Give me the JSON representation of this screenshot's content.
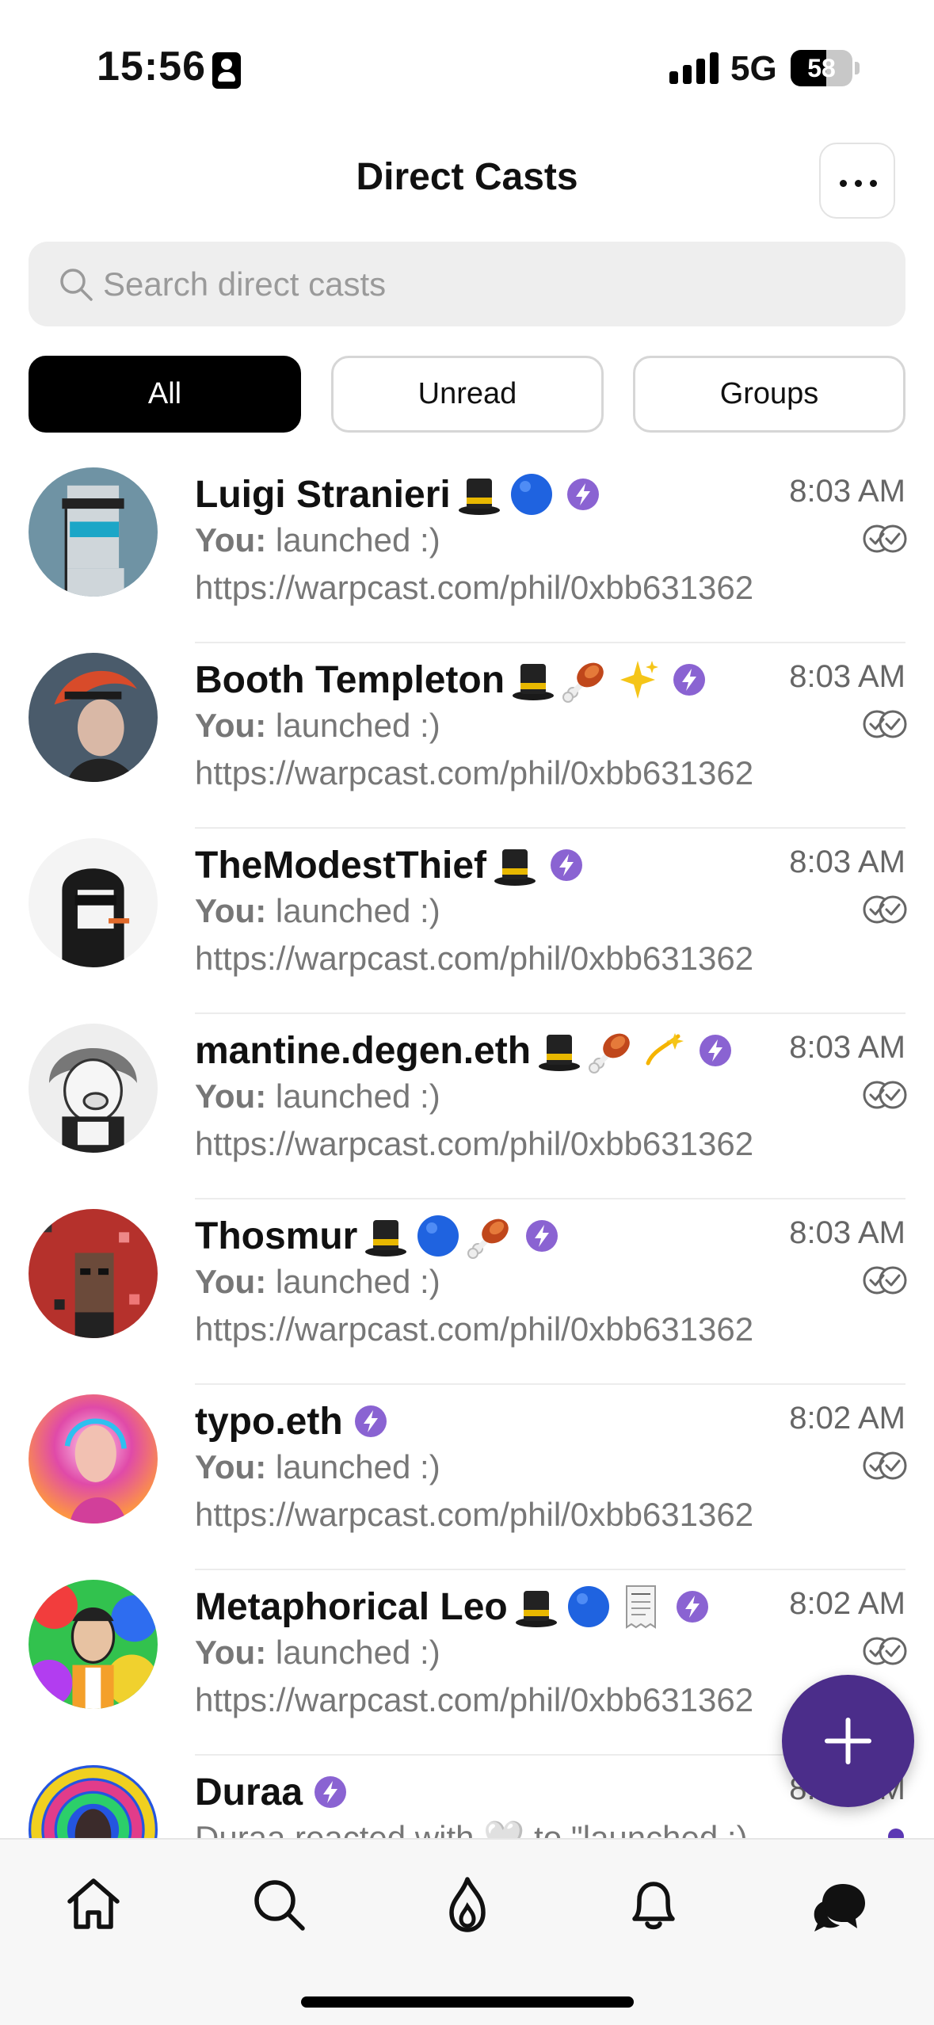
{
  "status_bar": {
    "time": "15:56",
    "network": "5G",
    "battery_level": "58",
    "battery_fraction": 0.58
  },
  "header": {
    "title": "Direct Casts",
    "more_icon": "ellipsis-icon"
  },
  "search": {
    "placeholder": "Search direct casts",
    "value": ""
  },
  "tabs": [
    {
      "label": "All",
      "active": true
    },
    {
      "label": "Unread",
      "active": false
    },
    {
      "label": "Groups",
      "active": false
    }
  ],
  "conversations": [
    {
      "name": "Luigi Stranieri",
      "emojis": [
        "top-hat",
        "blue-circle"
      ],
      "verified": true,
      "time": "8:03 AM",
      "sender": "You:",
      "message": "launched :)",
      "link": "https://warpcast.com/phil/0xbb631362",
      "status": "read"
    },
    {
      "name": "Booth Templeton",
      "emojis": [
        "top-hat",
        "meat-on-bone",
        "sparkles"
      ],
      "verified": true,
      "time": "8:03 AM",
      "sender": "You:",
      "message": "launched :)",
      "link": "https://warpcast.com/phil/0xbb631362",
      "status": "read"
    },
    {
      "name": "TheModestThief",
      "emojis": [
        "top-hat"
      ],
      "verified": true,
      "time": "8:03 AM",
      "sender": "You:",
      "message": "launched :)",
      "link": "https://warpcast.com/phil/0xbb631362",
      "status": "read"
    },
    {
      "name": "mantine.degen.eth",
      "emojis": [
        "top-hat",
        "meat-on-bone",
        "dizzy"
      ],
      "verified": true,
      "time": "8:03 AM",
      "sender": "You:",
      "message": "launched :)",
      "link": "https://warpcast.com/phil/0xbb631362",
      "status": "read"
    },
    {
      "name": "Thosmur",
      "emojis": [
        "top-hat",
        "blue-circle",
        "meat-on-bone"
      ],
      "verified": true,
      "time": "8:03 AM",
      "sender": "You:",
      "message": "launched :)",
      "link": "https://warpcast.com/phil/0xbb631362",
      "status": "read"
    },
    {
      "name": "typo.eth",
      "emojis": [],
      "verified": true,
      "time": "8:02 AM",
      "sender": "You:",
      "message": "launched :)",
      "link": "https://warpcast.com/phil/0xbb631362",
      "status": "read"
    },
    {
      "name": "Metaphorical Leo",
      "emojis": [
        "top-hat",
        "blue-circle",
        "receipt"
      ],
      "verified": true,
      "time": "8:02 AM",
      "sender": "You:",
      "message": "launched :)",
      "link": "https://warpcast.com/phil/0xbb631362",
      "status": "read"
    },
    {
      "name": "Duraa",
      "emojis": [],
      "verified": true,
      "time": "8:02 AM",
      "sender": "",
      "message": "Duraa reacted with 🤍 to \"launched :)",
      "link": "",
      "status": "unread"
    }
  ],
  "fab": {
    "icon": "plus-icon"
  },
  "bottom_nav": [
    {
      "icon": "home-icon",
      "active": false
    },
    {
      "icon": "search-icon",
      "active": false
    },
    {
      "icon": "flame-icon",
      "active": false
    },
    {
      "icon": "bell-icon",
      "active": false
    },
    {
      "icon": "chat-icon",
      "active": true
    }
  ],
  "colors": {
    "accent": "#4b2d8a",
    "verified": "#8a63d2",
    "text_primary": "#111111",
    "text_secondary": "#777777",
    "search_bg": "#eeeeee"
  }
}
